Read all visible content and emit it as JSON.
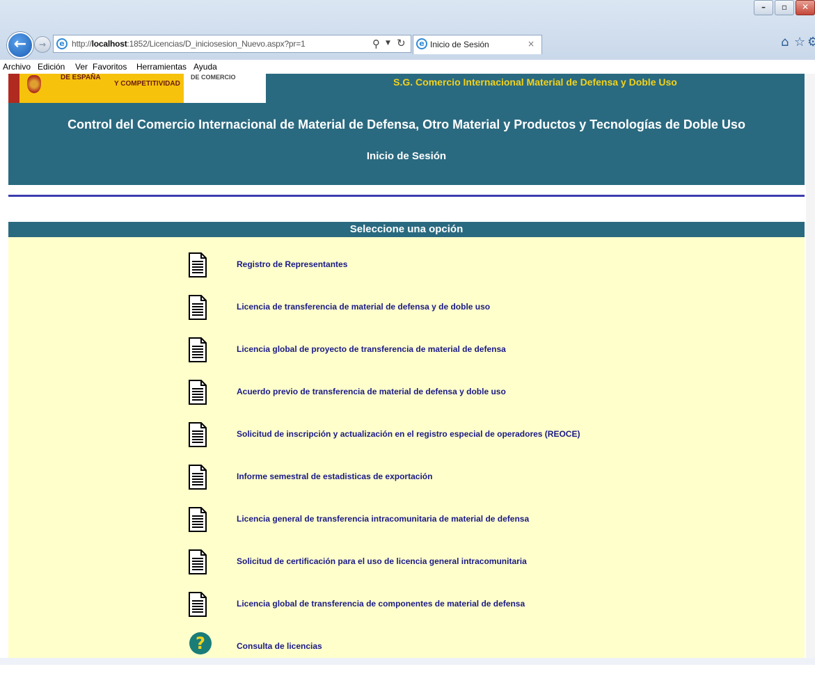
{
  "browser": {
    "url_prefix": "http://",
    "url_host": "localhost",
    "url_rest": ":1852/Licencias/D_iniciosesion_Nuevo.aspx?pr=1",
    "tab_title": "Inicio de Sesión",
    "tab_close": "×",
    "back_glyph": "←",
    "forward_glyph": "→",
    "window_buttons": {
      "minimize": "–",
      "maximize": "▫",
      "close": "✕"
    },
    "menu": [
      "Archivo",
      "Edición",
      "Ver",
      "Favoritos",
      "Herramientas",
      "Ayuda"
    ]
  },
  "header": {
    "logo_line1": "DE ESPAÑA",
    "logo_line2": "Y COMPETITIVIDAD",
    "logo_line3": "DE COMERCIO",
    "sg_title": "S.G. Comercio Internacional Material de Defensa y Doble Uso",
    "main_title": "Control del Comercio Internacional de Material de Defensa, Otro Material y Productos y Tecnologías de Doble Uso",
    "sub_title": "Inicio de Sesión"
  },
  "panel": {
    "title": "Seleccione una opción",
    "options": [
      {
        "label": "Registro de Representantes",
        "icon": "document-icon"
      },
      {
        "label": "Licencia de transferencia de material de defensa y de doble uso",
        "icon": "document-icon"
      },
      {
        "label": "Licencia global de proyecto de transferencia de material de defensa",
        "icon": "document-icon"
      },
      {
        "label": "Acuerdo previo de transferencia de material de defensa y doble uso",
        "icon": "document-icon"
      },
      {
        "label": "Solicitud de inscripción y actualización en el registro especial de operadores (REOCE)",
        "icon": "document-icon"
      },
      {
        "label": "Informe semestral de estadisticas de exportación",
        "icon": "document-icon"
      },
      {
        "label": "Licencia general de transferencia intracomunitaria de material de defensa",
        "icon": "document-icon"
      },
      {
        "label": "Solicitud de certificación para el uso de licencia general intracomunitaria",
        "icon": "document-icon"
      },
      {
        "label": "Licencia global de transferencia de componentes de material de defensa",
        "icon": "document-icon"
      },
      {
        "label": "Consulta de licencias",
        "icon": "help-icon",
        "glyph": "?"
      }
    ]
  },
  "colors": {
    "header_bg": "#2a6a80",
    "panel_bg": "#ffffcc",
    "link": "#1a1a86",
    "sg_title": "#f2d21a",
    "separator": "#3c3cae"
  }
}
